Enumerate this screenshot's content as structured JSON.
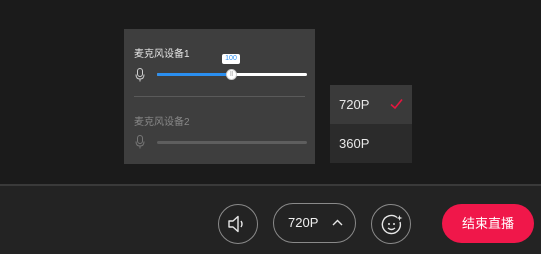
{
  "mic_panel": {
    "device1": {
      "label": "麦克风设备1",
      "volume": 100,
      "level": 0.5,
      "thumb_text": "||"
    },
    "device2": {
      "label": "麦克风设备2",
      "enabled": false
    }
  },
  "quality_menu": {
    "options": [
      {
        "label": "720P",
        "selected": true
      },
      {
        "label": "360P",
        "selected": false
      }
    ]
  },
  "bottom_bar": {
    "volume_icon": "speaker-icon",
    "quality_label": "720P",
    "effects_icon": "face-sparkle-icon",
    "end_live_label": "结束直播"
  },
  "colors": {
    "accent": "#f0174a",
    "slider_blue": "#2b8ff0",
    "check_red": "#e5163f"
  }
}
